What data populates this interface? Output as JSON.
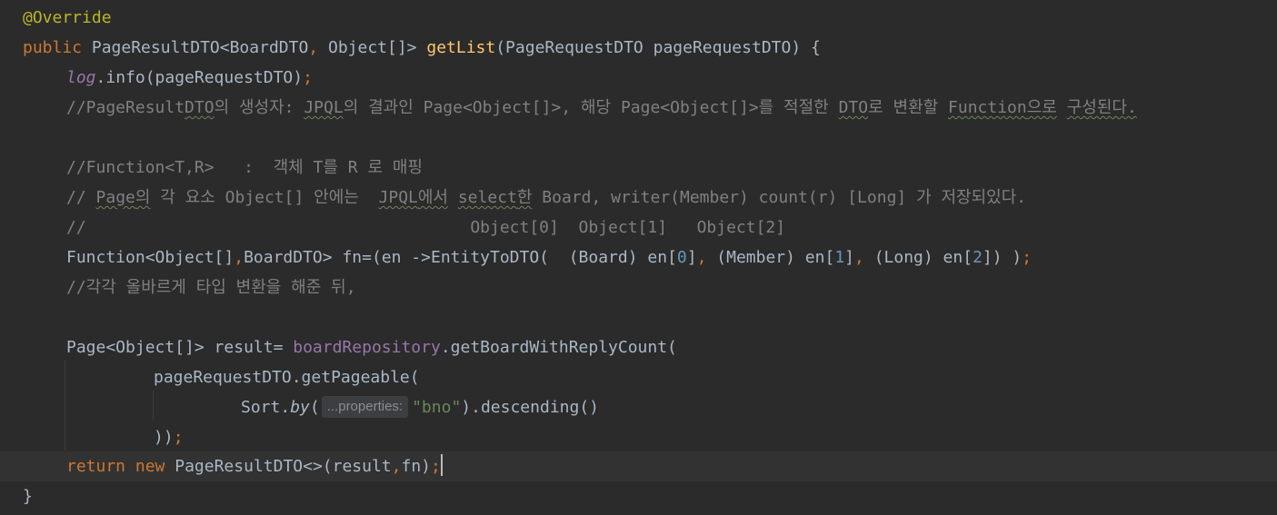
{
  "editor": {
    "tokens": {
      "annotation": "@Override",
      "kw_public": "public",
      "ret_type_a": "PageResultDTO<BoardDTO",
      "comma_a": ",",
      "ret_type_b": " Object[]> ",
      "method_name": "getList",
      "params": "(PageRequestDTO pageRequestDTO) {",
      "log_field": "log",
      "log_call": ".info(pageRequestDTO)",
      "semi": ";",
      "c1_a": "//PageResult",
      "c1_b": "DTO",
      "c1_c": "의 생성자: ",
      "c1_d": "JPQL",
      "c1_e": "의 결과인 Page<Object[]>, 해당 Page<Object[]>를 적절한 ",
      "c1_f": "DTO",
      "c1_g": "로 변환할 ",
      "c1_h": "Function",
      "c1_i": "으로",
      "c1_j": " ",
      "c1_k": "구성된다.",
      "c2": "//Function<T,R>   :  객체 T를 R 로 매핑",
      "c3_a": "// ",
      "c3_b": "Page",
      "c3_c": "의",
      "c3_d": " 각 요소 Object[] 안에는  ",
      "c3_e": "JPQL",
      "c3_f": "에서",
      "c3_g": " ",
      "c3_h": "select",
      "c3_i": "한",
      "c3_j": " Board, writer(Member) count(r) [Long] 가 저장되있다.",
      "c4": "//                                       Object[0]  Object[1]   Object[2]",
      "fn_a": "Function<Object[]",
      "fn_comma": ",",
      "fn_b": "BoardDTO> fn=(en ->EntityToDTO(  (Board) en[",
      "n0": "0",
      "fn_c": "]",
      "fn_comma2": ",",
      "fn_d": " (Member) en[",
      "n1": "1",
      "fn_e": "]",
      "fn_comma3": ",",
      "fn_f": " (Long) en[",
      "n2": "2",
      "fn_g": "]) )",
      "fn_semi": ";",
      "c5": "//각각 올바르게 타입 변환을 해준 뒤,",
      "page_a": "Page<Object[]> result= ",
      "repo_field": "boardRepository",
      "repo_call": ".getBoardWithReplyCount(",
      "pageable": "pageRequestDTO.getPageable(",
      "sort_cls": "Sort.",
      "sort_by": "by",
      "sort_open": "(",
      "hint": "...properties:",
      "bno": "\"bno\"",
      "sort_rest": ").descending()",
      "close_parens": "))",
      "close_semi": ";",
      "kw_return": "return",
      "kw_new": "new",
      "ret_rest": "PageResultDTO<>(result",
      "ret_comma": ",",
      "ret_rest2": "fn)",
      "ret_semi": ";",
      "brace_close": "}"
    }
  }
}
